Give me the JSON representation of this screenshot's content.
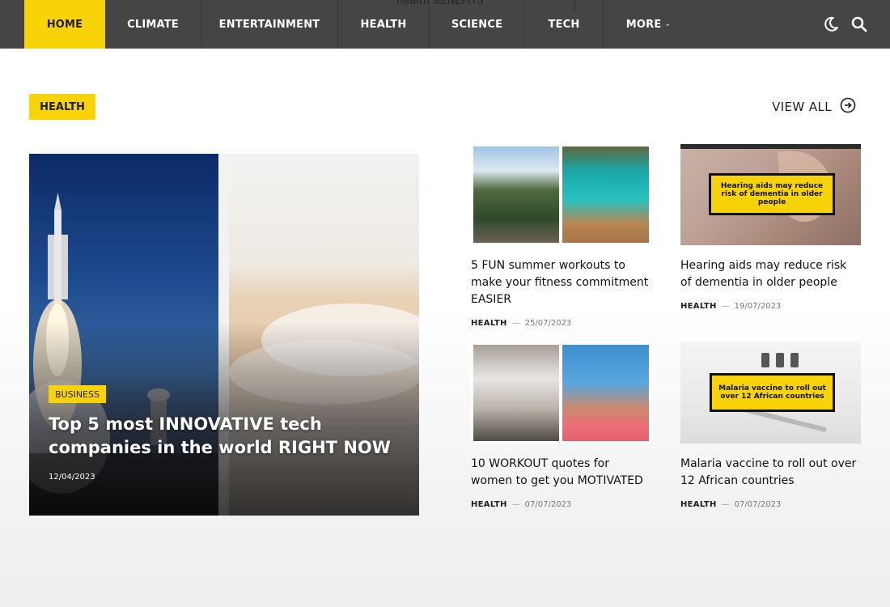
{
  "nav": {
    "items": [
      {
        "label": "HOME",
        "active": true
      },
      {
        "label": "CLIMATE"
      },
      {
        "label": "ENTERTAINMENT"
      },
      {
        "label": "HEALTH"
      },
      {
        "label": "SCIENCE"
      },
      {
        "label": "TECH"
      },
      {
        "label": "MORE"
      }
    ],
    "ghost_text": "health BENEFITS",
    "icons": [
      "moon-icon",
      "search-icon"
    ]
  },
  "section": {
    "badge": "HEALTH",
    "view_all": "VIEW ALL"
  },
  "featured": {
    "category": "BUSINESS",
    "title": "Top 5 most INNOVATIVE tech companies in the world RIGHT NOW",
    "date": "12/04/2023"
  },
  "cards": [
    {
      "title": "5 FUN summer workouts to make your fitness commitment EASIER",
      "category": "HEALTH",
      "date": "25/07/2023"
    },
    {
      "title": "Hearing aids may reduce risk of dementia in older people",
      "category": "HEALTH",
      "date": "19/07/2023",
      "image_label": "Hearing aids may reduce risk of dementia in older people"
    },
    {
      "title": "10 WORKOUT quotes for women to get you MOTIVATED",
      "category": "HEALTH",
      "date": "07/07/2023"
    },
    {
      "title": "Malaria vaccine to roll out over 12 African countries",
      "category": "HEALTH",
      "date": "07/07/2023",
      "image_label": "Malaria vaccine to roll out over 12 African countries"
    }
  ],
  "colors": {
    "accent": "#f7d308",
    "nav_bg": "#454545"
  }
}
